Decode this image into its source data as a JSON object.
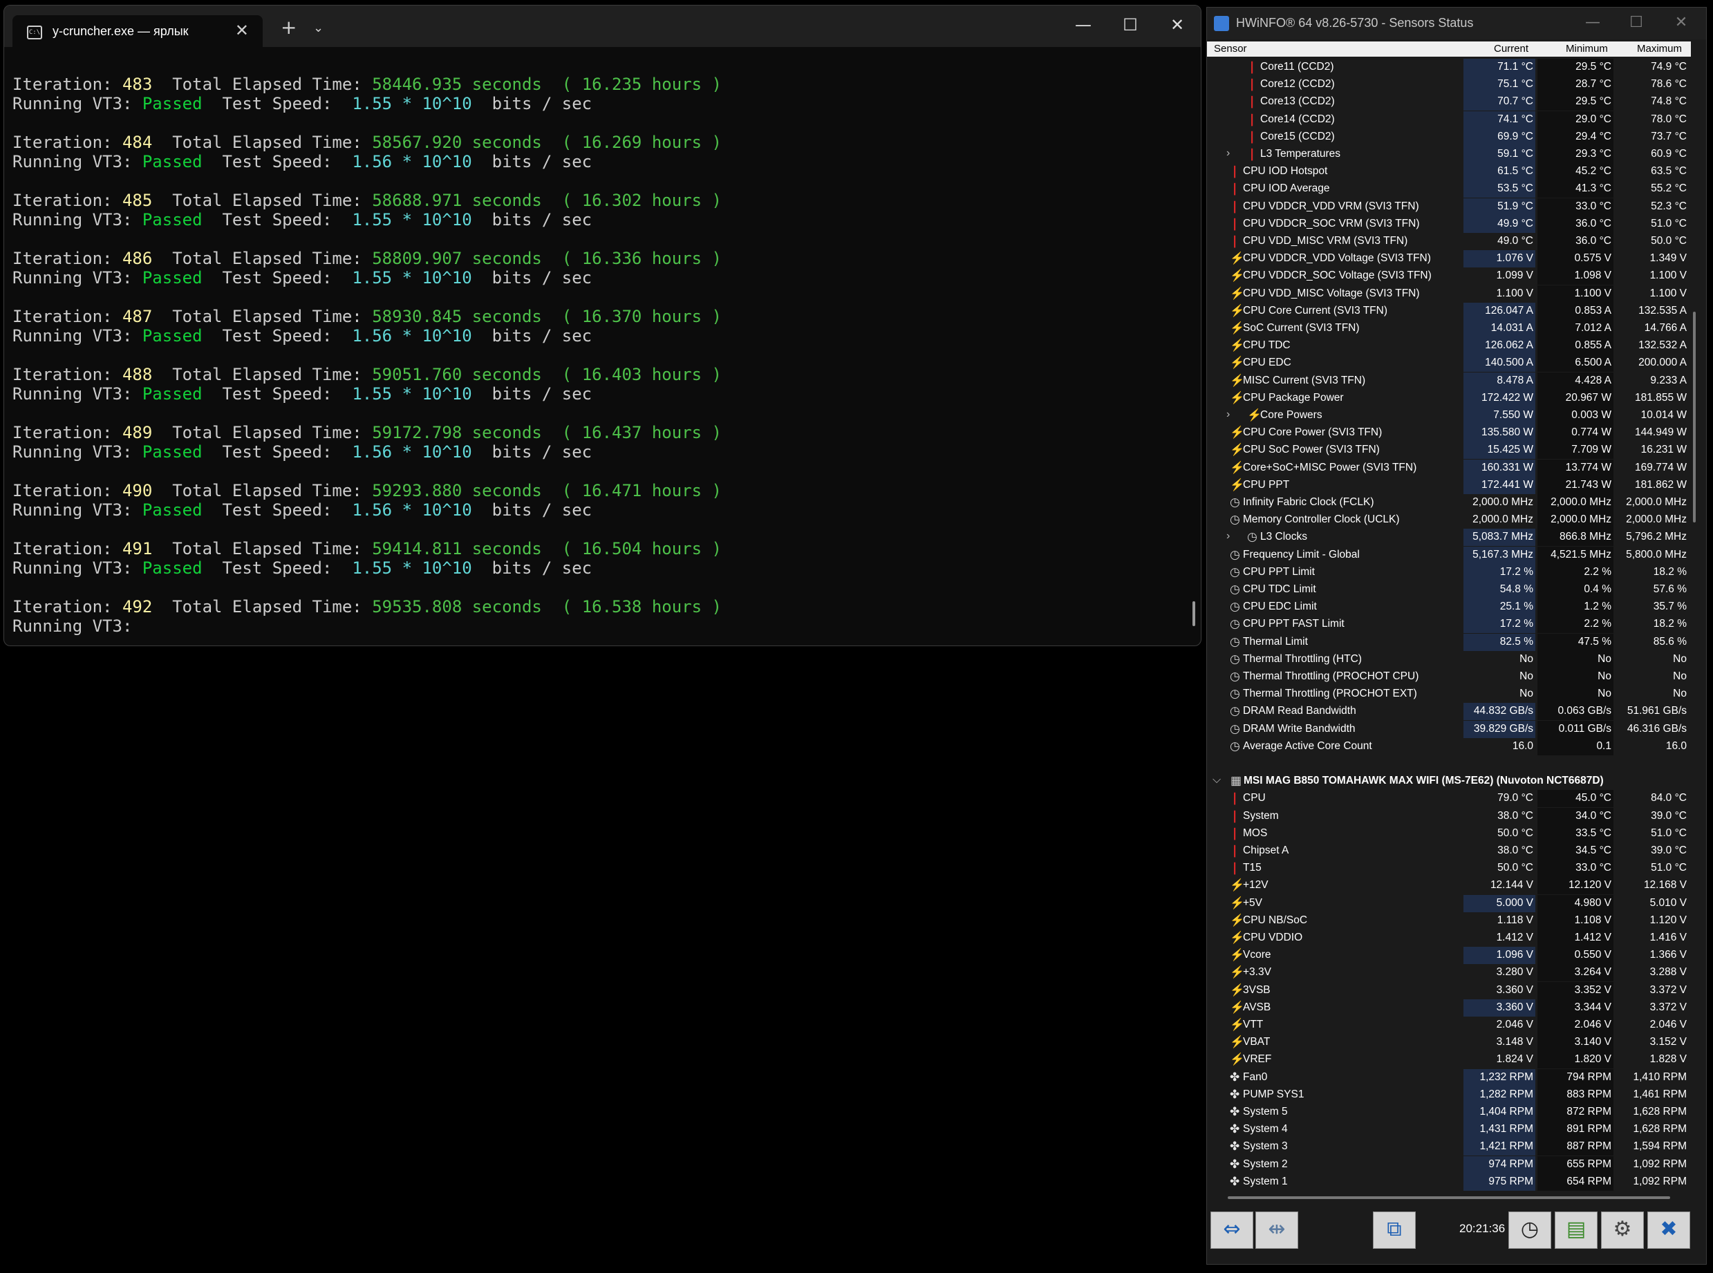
{
  "terminal": {
    "tab_title": "y-cruncher.exe — ярлык",
    "tab_icon": "terminal-icon",
    "new_tab": "+",
    "dropdown": "⌄",
    "minimize": "—",
    "maximize": "☐",
    "close": "✕",
    "labels": {
      "iteration": "Iteration:",
      "elapsed": "Total Elapsed Time:",
      "seconds": "seconds",
      "hours": "hours )",
      "open_paren": "(",
      "running": "Running VT3:",
      "passed": "Passed",
      "test_speed": "Test Speed:",
      "times": "* 10^10",
      "bits": "bits / sec"
    },
    "iterations": [
      {
        "iter": "483",
        "elapsed": "58446.935",
        "hours": "16.235",
        "speed": "1.55"
      },
      {
        "iter": "484",
        "elapsed": "58567.920",
        "hours": "16.269",
        "speed": "1.56"
      },
      {
        "iter": "485",
        "elapsed": "58688.971",
        "hours": "16.302",
        "speed": "1.55"
      },
      {
        "iter": "486",
        "elapsed": "58809.907",
        "hours": "16.336",
        "speed": "1.55"
      },
      {
        "iter": "487",
        "elapsed": "58930.845",
        "hours": "16.370",
        "speed": "1.56"
      },
      {
        "iter": "488",
        "elapsed": "59051.760",
        "hours": "16.403",
        "speed": "1.55"
      },
      {
        "iter": "489",
        "elapsed": "59172.798",
        "hours": "16.437",
        "speed": "1.56"
      },
      {
        "iter": "490",
        "elapsed": "59293.880",
        "hours": "16.471",
        "speed": "1.56"
      },
      {
        "iter": "491",
        "elapsed": "59414.811",
        "hours": "16.504",
        "speed": "1.55"
      }
    ],
    "last": {
      "iter": "492",
      "elapsed": "59535.808",
      "hours": "16.538"
    }
  },
  "hwinfo": {
    "title": "HWiNFO® 64 v8.26-5730 - Sensors Status",
    "minimize": "—",
    "maximize": "☐",
    "close": "✕",
    "header": {
      "sensor": "Sensor",
      "current": "Current",
      "minimum": "Minimum",
      "maximum": "Maximum"
    },
    "rows": [
      {
        "icon": "t",
        "indent": 2,
        "name": "Core11 (CCD2)",
        "cur": "71.1 °C",
        "min": "29.5 °C",
        "max": "74.9 °C",
        "hl": true
      },
      {
        "icon": "t",
        "indent": 2,
        "name": "Core12 (CCD2)",
        "cur": "75.1 °C",
        "min": "28.7 °C",
        "max": "78.6 °C",
        "hl": true
      },
      {
        "icon": "t",
        "indent": 2,
        "name": "Core13 (CCD2)",
        "cur": "70.7 °C",
        "min": "29.5 °C",
        "max": "74.8 °C",
        "hl": true
      },
      {
        "icon": "t",
        "indent": 2,
        "name": "Core14 (CCD2)",
        "cur": "74.1 °C",
        "min": "29.0 °C",
        "max": "78.0 °C",
        "hl": true
      },
      {
        "icon": "t",
        "indent": 2,
        "name": "Core15 (CCD2)",
        "cur": "69.9 °C",
        "min": "29.4 °C",
        "max": "73.7 °C",
        "hl": true
      },
      {
        "icon": "t",
        "indent": 2,
        "exp": true,
        "name": "L3 Temperatures",
        "cur": "59.1 °C",
        "min": "29.3 °C",
        "max": "60.9 °C",
        "hl": true
      },
      {
        "icon": "t",
        "indent": 1,
        "name": "CPU IOD Hotspot",
        "cur": "61.5 °C",
        "min": "45.2 °C",
        "max": "63.5 °C",
        "hl": true
      },
      {
        "icon": "t",
        "indent": 1,
        "name": "CPU IOD Average",
        "cur": "53.5 °C",
        "min": "41.3 °C",
        "max": "55.2 °C",
        "hl": true
      },
      {
        "icon": "t",
        "indent": 1,
        "name": "CPU VDDCR_VDD VRM (SVI3 TFN)",
        "cur": "51.9 °C",
        "min": "33.0 °C",
        "max": "52.3 °C",
        "hl": true
      },
      {
        "icon": "t",
        "indent": 1,
        "name": "CPU VDDCR_SOC VRM (SVI3 TFN)",
        "cur": "49.9 °C",
        "min": "36.0 °C",
        "max": "51.0 °C",
        "hl": true
      },
      {
        "icon": "t",
        "indent": 1,
        "name": "CPU VDD_MISC VRM (SVI3 TFN)",
        "cur": "49.0 °C",
        "min": "36.0 °C",
        "max": "50.0 °C",
        "hl": false
      },
      {
        "icon": "v",
        "indent": 1,
        "name": "CPU VDDCR_VDD Voltage (SVI3 TFN)",
        "cur": "1.076 V",
        "min": "0.575 V",
        "max": "1.349 V",
        "hl": true
      },
      {
        "icon": "v",
        "indent": 1,
        "name": "CPU VDDCR_SOC Voltage (SVI3 TFN)",
        "cur": "1.099 V",
        "min": "1.098 V",
        "max": "1.100 V",
        "hl": false
      },
      {
        "icon": "v",
        "indent": 1,
        "name": "CPU VDD_MISC Voltage (SVI3 TFN)",
        "cur": "1.100 V",
        "min": "1.100 V",
        "max": "1.100 V",
        "hl": false
      },
      {
        "icon": "v",
        "indent": 1,
        "name": "CPU Core Current (SVI3 TFN)",
        "cur": "126.047 A",
        "min": "0.853 A",
        "max": "132.535 A",
        "hl": true
      },
      {
        "icon": "v",
        "indent": 1,
        "name": "SoC Current (SVI3 TFN)",
        "cur": "14.031 A",
        "min": "7.012 A",
        "max": "14.766 A",
        "hl": true
      },
      {
        "icon": "v",
        "indent": 1,
        "name": "CPU TDC",
        "cur": "126.062 A",
        "min": "0.855 A",
        "max": "132.532 A",
        "hl": true
      },
      {
        "icon": "v",
        "indent": 1,
        "name": "CPU EDC",
        "cur": "140.500 A",
        "min": "6.500 A",
        "max": "200.000 A",
        "hl": true
      },
      {
        "icon": "v",
        "indent": 1,
        "name": "MISC Current (SVI3 TFN)",
        "cur": "8.478 A",
        "min": "4.428 A",
        "max": "9.233 A",
        "hl": true
      },
      {
        "icon": "v",
        "indent": 1,
        "name": "CPU Package Power",
        "cur": "172.422 W",
        "min": "20.967 W",
        "max": "181.855 W",
        "hl": true
      },
      {
        "icon": "v",
        "indent": 2,
        "exp": true,
        "name": "Core Powers",
        "cur": "7.550 W",
        "min": "0.003 W",
        "max": "10.014 W",
        "hl": true
      },
      {
        "icon": "v",
        "indent": 1,
        "name": "CPU Core Power (SVI3 TFN)",
        "cur": "135.580 W",
        "min": "0.774 W",
        "max": "144.949 W",
        "hl": true
      },
      {
        "icon": "v",
        "indent": 1,
        "name": "CPU SoC Power (SVI3 TFN)",
        "cur": "15.425 W",
        "min": "7.709 W",
        "max": "16.231 W",
        "hl": true
      },
      {
        "icon": "v",
        "indent": 1,
        "name": "Core+SoC+MISC Power (SVI3 TFN)",
        "cur": "160.331 W",
        "min": "13.774 W",
        "max": "169.774 W",
        "hl": true
      },
      {
        "icon": "v",
        "indent": 1,
        "name": "CPU PPT",
        "cur": "172.441 W",
        "min": "21.743 W",
        "max": "181.862 W",
        "hl": true
      },
      {
        "icon": "c",
        "indent": 1,
        "name": "Infinity Fabric Clock (FCLK)",
        "cur": "2,000.0 MHz",
        "min": "2,000.0 MHz",
        "max": "2,000.0 MHz",
        "hl": false
      },
      {
        "icon": "c",
        "indent": 1,
        "name": "Memory Controller Clock (UCLK)",
        "cur": "2,000.0 MHz",
        "min": "2,000.0 MHz",
        "max": "2,000.0 MHz",
        "hl": false
      },
      {
        "icon": "c",
        "indent": 2,
        "exp": true,
        "name": "L3 Clocks",
        "cur": "5,083.7 MHz",
        "min": "866.8 MHz",
        "max": "5,796.2 MHz",
        "hl": true
      },
      {
        "icon": "c",
        "indent": 1,
        "name": "Frequency Limit - Global",
        "cur": "5,167.3 MHz",
        "min": "4,521.5 MHz",
        "max": "5,800.0 MHz",
        "hl": true
      },
      {
        "icon": "c",
        "indent": 1,
        "name": "CPU PPT Limit",
        "cur": "17.2 %",
        "min": "2.2 %",
        "max": "18.2 %",
        "hl": true
      },
      {
        "icon": "c",
        "indent": 1,
        "name": "CPU TDC Limit",
        "cur": "54.8 %",
        "min": "0.4 %",
        "max": "57.6 %",
        "hl": true
      },
      {
        "icon": "c",
        "indent": 1,
        "name": "CPU EDC Limit",
        "cur": "25.1 %",
        "min": "1.2 %",
        "max": "35.7 %",
        "hl": true
      },
      {
        "icon": "c",
        "indent": 1,
        "name": "CPU PPT FAST Limit",
        "cur": "17.2 %",
        "min": "2.2 %",
        "max": "18.2 %",
        "hl": true
      },
      {
        "icon": "c",
        "indent": 1,
        "name": "Thermal Limit",
        "cur": "82.5 %",
        "min": "47.5 %",
        "max": "85.6 %",
        "hl": true
      },
      {
        "icon": "c",
        "indent": 1,
        "name": "Thermal Throttling (HTC)",
        "cur": "No",
        "min": "No",
        "max": "No",
        "hl": false
      },
      {
        "icon": "c",
        "indent": 1,
        "name": "Thermal Throttling (PROCHOT CPU)",
        "cur": "No",
        "min": "No",
        "max": "No",
        "hl": false
      },
      {
        "icon": "c",
        "indent": 1,
        "name": "Thermal Throttling (PROCHOT EXT)",
        "cur": "No",
        "min": "No",
        "max": "No",
        "hl": false
      },
      {
        "icon": "c",
        "indent": 1,
        "name": "DRAM Read Bandwidth",
        "cur": "44.832 GB/s",
        "min": "0.063 GB/s",
        "max": "51.961 GB/s",
        "hl": true
      },
      {
        "icon": "c",
        "indent": 1,
        "name": "DRAM Write Bandwidth",
        "cur": "39.829 GB/s",
        "min": "0.011 GB/s",
        "max": "46.316 GB/s",
        "hl": true
      },
      {
        "icon": "c",
        "indent": 1,
        "name": "Average Active Core Count",
        "cur": "16.0",
        "min": "0.1",
        "max": "16.0",
        "hl": false
      },
      {
        "blank": true
      },
      {
        "group": true,
        "name": "MSI MAG B850 TOMAHAWK MAX WIFI (MS-7E62) (Nuvoton NCT6687D)"
      },
      {
        "icon": "t",
        "indent": 1,
        "name": "CPU",
        "cur": "79.0 °C",
        "min": "45.0 °C",
        "max": "84.0 °C",
        "hl": false
      },
      {
        "icon": "t",
        "indent": 1,
        "name": "System",
        "cur": "38.0 °C",
        "min": "34.0 °C",
        "max": "39.0 °C",
        "hl": false
      },
      {
        "icon": "t",
        "indent": 1,
        "name": "MOS",
        "cur": "50.0 °C",
        "min": "33.5 °C",
        "max": "51.0 °C",
        "hl": false
      },
      {
        "icon": "t",
        "indent": 1,
        "name": "Chipset A",
        "cur": "38.0 °C",
        "min": "34.5 °C",
        "max": "39.0 °C",
        "hl": false
      },
      {
        "icon": "t",
        "indent": 1,
        "name": "T15",
        "cur": "50.0 °C",
        "min": "33.0 °C",
        "max": "51.0 °C",
        "hl": false
      },
      {
        "icon": "v",
        "indent": 1,
        "name": "+12V",
        "cur": "12.144 V",
        "min": "12.120 V",
        "max": "12.168 V",
        "hl": false
      },
      {
        "icon": "v",
        "indent": 1,
        "name": "+5V",
        "cur": "5.000 V",
        "min": "4.980 V",
        "max": "5.010 V",
        "hl": true
      },
      {
        "icon": "v",
        "indent": 1,
        "name": "CPU NB/SoC",
        "cur": "1.118 V",
        "min": "1.108 V",
        "max": "1.120 V",
        "hl": false
      },
      {
        "icon": "v",
        "indent": 1,
        "name": "CPU VDDIO",
        "cur": "1.412 V",
        "min": "1.412 V",
        "max": "1.416 V",
        "hl": false
      },
      {
        "icon": "v",
        "indent": 1,
        "name": "Vcore",
        "cur": "1.096 V",
        "min": "0.550 V",
        "max": "1.366 V",
        "hl": true
      },
      {
        "icon": "v",
        "indent": 1,
        "name": "+3.3V",
        "cur": "3.280 V",
        "min": "3.264 V",
        "max": "3.288 V",
        "hl": false
      },
      {
        "icon": "v",
        "indent": 1,
        "name": "3VSB",
        "cur": "3.360 V",
        "min": "3.352 V",
        "max": "3.372 V",
        "hl": false
      },
      {
        "icon": "v",
        "indent": 1,
        "name": "AVSB",
        "cur": "3.360 V",
        "min": "3.344 V",
        "max": "3.372 V",
        "hl": true
      },
      {
        "icon": "v",
        "indent": 1,
        "name": "VTT",
        "cur": "2.046 V",
        "min": "2.046 V",
        "max": "2.046 V",
        "hl": false
      },
      {
        "icon": "v",
        "indent": 1,
        "name": "VBAT",
        "cur": "3.148 V",
        "min": "3.140 V",
        "max": "3.152 V",
        "hl": false
      },
      {
        "icon": "v",
        "indent": 1,
        "name": "VREF",
        "cur": "1.824 V",
        "min": "1.820 V",
        "max": "1.828 V",
        "hl": false
      },
      {
        "icon": "f",
        "indent": 1,
        "name": "Fan0",
        "cur": "1,232 RPM",
        "min": "794 RPM",
        "max": "1,410 RPM",
        "hl": true
      },
      {
        "icon": "f",
        "indent": 1,
        "name": "PUMP SYS1",
        "cur": "1,282 RPM",
        "min": "883 RPM",
        "max": "1,461 RPM",
        "hl": true
      },
      {
        "icon": "f",
        "indent": 1,
        "name": "System 5",
        "cur": "1,404 RPM",
        "min": "872 RPM",
        "max": "1,628 RPM",
        "hl": true
      },
      {
        "icon": "f",
        "indent": 1,
        "name": "System 4",
        "cur": "1,431 RPM",
        "min": "891 RPM",
        "max": "1,628 RPM",
        "hl": true
      },
      {
        "icon": "f",
        "indent": 1,
        "name": "System 3",
        "cur": "1,421 RPM",
        "min": "887 RPM",
        "max": "1,594 RPM",
        "hl": true
      },
      {
        "icon": "f",
        "indent": 1,
        "name": "System 2",
        "cur": "974 RPM",
        "min": "655 RPM",
        "max": "1,092 RPM",
        "hl": true
      },
      {
        "icon": "f",
        "indent": 1,
        "name": "System 1",
        "cur": "975 RPM",
        "min": "654 RPM",
        "max": "1,092 RPM",
        "hl": true
      }
    ],
    "toolbar": {
      "clock": "20:21:36",
      "expand_icon": "expand-arrows-icon",
      "collapse_icon": "collapse-arrows-icon",
      "network_icon": "network-icon",
      "timer_icon": "clock-icon",
      "log_icon": "log-file-icon",
      "settings_icon": "gear-icon",
      "close_icon": "close-icon"
    }
  }
}
